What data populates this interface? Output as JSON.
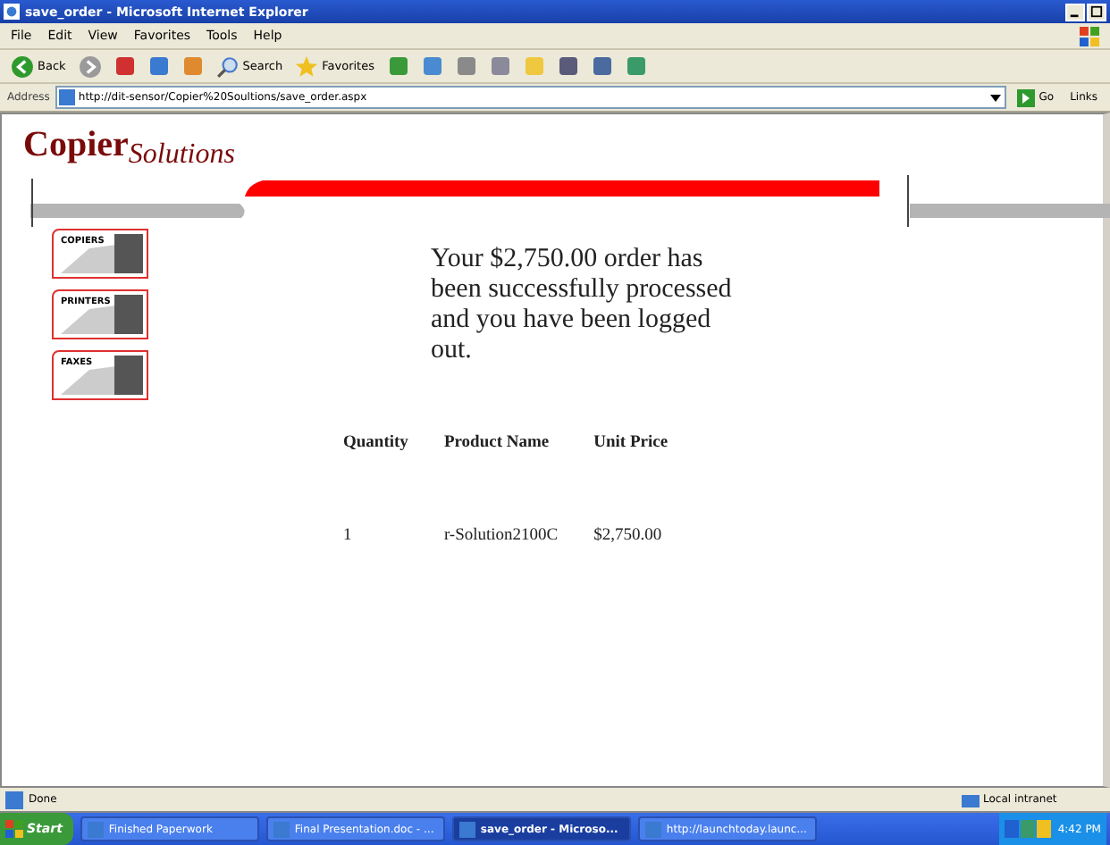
{
  "window": {
    "title": "save_order - Microsoft Internet Explorer"
  },
  "menu": [
    "File",
    "Edit",
    "View",
    "Favorites",
    "Tools",
    "Help"
  ],
  "toolbar": [
    {
      "kind": "back",
      "label": "Back"
    },
    {
      "kind": "forward"
    },
    {
      "kind": "stop"
    },
    {
      "kind": "refresh"
    },
    {
      "kind": "home"
    },
    {
      "kind": "search",
      "label": "Search"
    },
    {
      "kind": "favorites",
      "label": "Favorites"
    },
    {
      "kind": "history"
    },
    {
      "kind": "mail"
    },
    {
      "kind": "print"
    },
    {
      "kind": "edit"
    },
    {
      "kind": "folder"
    },
    {
      "kind": "page"
    },
    {
      "kind": "tools"
    },
    {
      "kind": "messenger"
    }
  ],
  "address": {
    "label": "Address",
    "url": "http://dit-sensor/Copier%20Soultions/save_order.aspx",
    "go": "Go",
    "links": "Links"
  },
  "page": {
    "logo": {
      "main": "Copier",
      "sub": "Solutions"
    },
    "nav": [
      {
        "label": "COPIERS"
      },
      {
        "label": "PRINTERS"
      },
      {
        "label": "FAXES"
      }
    ],
    "message": "Your $2,750.00 order has been successfully processed and you have been logged out.",
    "table": {
      "columns": [
        "Quantity",
        "Product Name",
        "Unit Price"
      ],
      "rows": [
        [
          "1",
          "r-Solution2100C",
          "$2,750.00"
        ]
      ]
    }
  },
  "status_bar": {
    "text": "Done",
    "zone": "Local intranet"
  },
  "taskbar": {
    "start": "Start",
    "items": [
      {
        "label": "Finished Paperwork",
        "selected": false
      },
      {
        "label": "Final Presentation.doc - ...",
        "selected": false
      },
      {
        "label": "save_order - Microso...",
        "selected": true
      },
      {
        "label": "http://launchtoday.launc...",
        "selected": false
      }
    ],
    "clock": "4:42 PM"
  }
}
